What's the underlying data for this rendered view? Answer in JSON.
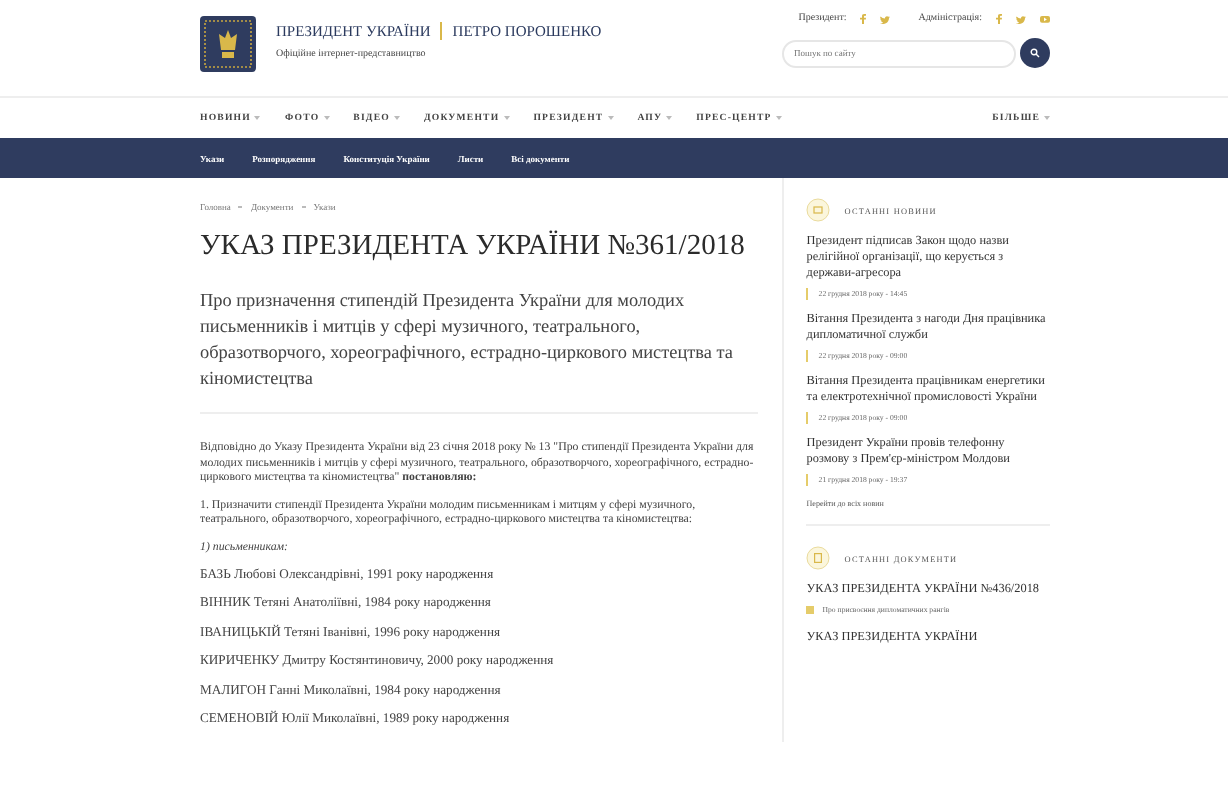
{
  "header": {
    "title": "ПРЕЗИДЕНТ УКРАЇНИ",
    "name": "ПЕТРО ПОРОШЕНКО",
    "subtitle": "Офіційне інтернет-представництво",
    "social": [
      {
        "label": "Президент:",
        "icons": [
          {
            "kind": "facebook"
          },
          {
            "kind": "twitter"
          }
        ]
      },
      {
        "label": "Адміністрація:",
        "icons": [
          {
            "kind": "facebook"
          },
          {
            "kind": "twitter"
          },
          {
            "kind": "youtube"
          }
        ]
      }
    ],
    "search": {
      "placeholder": "Пошук по сайту"
    }
  },
  "nav": [
    "НОВИНИ",
    "ФОТО",
    "ВІДЕО",
    "ДОКУМЕНТИ",
    "ПРЕЗИДЕНТ",
    "АПУ",
    "ПРЕС-ЦЕНТР",
    "БІЛЬШЕ"
  ],
  "subnav": [
    "Укази",
    "Розпорядження",
    "Конституція України",
    "Листи",
    "Всі документи"
  ],
  "breadcrumb": [
    "Головна",
    "Документи",
    "Укази"
  ],
  "article": {
    "title": "УКАЗ ПРЕЗИДЕНТА УКРАЇНИ №361/2018",
    "subtitle": "Про призначення стипендій Президента України для молодих письменників і митців у сфері музичного, театрального, образотворчого, хореографічного, естрадно-циркового мистецтва та кіномистецтва",
    "paragraphs": [
      {
        "kind": "text",
        "text": "Відповідно до Указу Президента України від 23 січня 2018 року № 13 \"Про стипендії Президента України для молодих письменників і митців у сфері музичного, театрального, образотворчого, хореографічного, естрадно-циркового мистецтва та кіномистецтва\" **постановляю:**"
      },
      {
        "kind": "text",
        "text": "1. Призначити стипендії Президента України молодим письменникам і митцям у сфері музичного, театрального, образотворчого, хореографічного, естрадно-циркового мистецтва та кіномистецтва:"
      },
      {
        "kind": "subhead",
        "text": "1) письменникам:"
      },
      {
        "kind": "name",
        "text": "БАЗЬ Любові Олександрівні, 1991 року народження"
      },
      {
        "kind": "name",
        "text": "ВІННИК Тетяні Анатоліївні, 1984 року народження"
      },
      {
        "kind": "name",
        "text": "ІВАНИЦЬКІЙ Тетяні Іванівні, 1996 року народження"
      },
      {
        "kind": "name",
        "text": "КИРИЧЕНКУ Дмитру Костянтиновичу, 2000 року народження"
      },
      {
        "kind": "name",
        "text": "МАЛИГОН Ганні Миколаївні, 1984 року народження"
      },
      {
        "kind": "name",
        "text": "СЕМЕНОВІЙ Юлії Миколаївні, 1989 року народження"
      }
    ]
  },
  "sidebar": {
    "news": {
      "heading": "ОСТАННІ НОВИНИ",
      "items": [
        {
          "title": "Президент підписав Закон щодо назви релігійної організації, що керується з держави-агресора",
          "date": "22 грудня 2018 року - 14:45"
        },
        {
          "title": "Вітання Президента з нагоди Дня працівника дипломатичної служби",
          "date": "22 грудня 2018 року - 09:00"
        },
        {
          "title": "Вітання Президента працівникам енергетики та електротехнічної промисловості України",
          "date": "22 грудня 2018 року - 09:00"
        },
        {
          "title": "Президент України провів телефонну розмову з Прем'єр-міністром Молдови",
          "date": "21 грудня 2018 року - 19:37"
        }
      ],
      "more": "Перейти до всіх новин"
    },
    "documents": {
      "heading": "ОСТАННІ ДОКУМЕНТИ",
      "items": [
        {
          "title": "УКАЗ ПРЕЗИДЕНТА УКРАЇНИ №436/2018",
          "note": "Про присвоєння дипломатичних рангів"
        },
        {
          "title": "УКАЗ ПРЕЗИДЕНТА УКРАЇНИ"
        }
      ]
    }
  }
}
